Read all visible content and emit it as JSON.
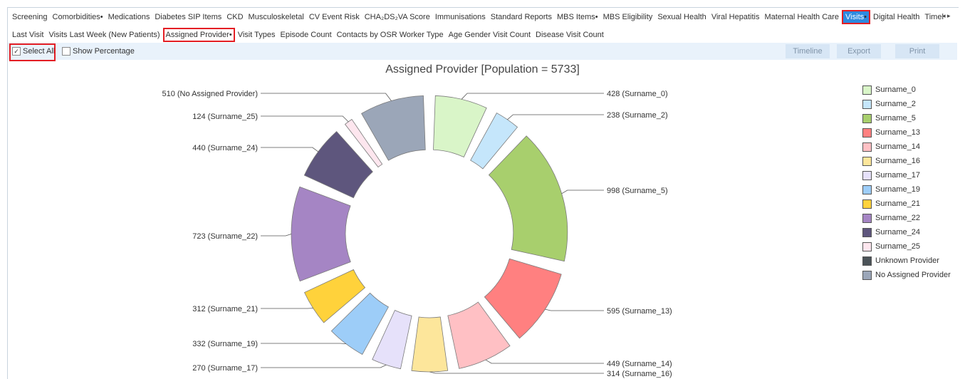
{
  "nav": {
    "tabs": [
      {
        "label": "Screening",
        "dot": false
      },
      {
        "label": "Comorbidities",
        "dot": true
      },
      {
        "label": "Medications",
        "dot": false
      },
      {
        "label": "Diabetes SIP Items",
        "dot": false
      },
      {
        "label": "CKD",
        "dot": false
      },
      {
        "label": "Musculoskeletal",
        "dot": false
      },
      {
        "label": "CV Event Risk",
        "dot": false
      },
      {
        "label": "CHA₂DS₂VA Score",
        "dot": false
      },
      {
        "label": "Immunisations",
        "dot": false
      },
      {
        "label": "Standard Reports",
        "dot": false
      },
      {
        "label": "MBS Items",
        "dot": true
      },
      {
        "label": "MBS Eligibility",
        "dot": false
      },
      {
        "label": "Sexual Health",
        "dot": false
      },
      {
        "label": "Viral Hepatitis",
        "dot": false
      },
      {
        "label": "Maternal Health Care",
        "dot": false
      },
      {
        "label": "Visits",
        "dot": true,
        "active": true
      },
      {
        "label": "Digital Health",
        "dot": false
      },
      {
        "label": "Timel",
        "dot": false
      }
    ],
    "scroll_arrows": "◂ ▸",
    "dot_char": "•"
  },
  "subnav": {
    "tabs": [
      {
        "label": "Last Visit",
        "dot": false
      },
      {
        "label": "Visits Last Week (New Patients)",
        "dot": false
      },
      {
        "label": "Assigned Provider",
        "dot": true,
        "active": true
      },
      {
        "label": "Visit Types",
        "dot": false
      },
      {
        "label": "Episode Count",
        "dot": false
      },
      {
        "label": "Contacts by OSR Worker Type",
        "dot": false
      },
      {
        "label": "Age Gender Visit Count",
        "dot": false
      },
      {
        "label": "Disease Visit Count",
        "dot": false
      }
    ]
  },
  "toolbar": {
    "select_all": "Select All",
    "select_all_checked": true,
    "check_mark": "✓",
    "show_percentage": "Show Percentage",
    "show_percentage_checked": false,
    "buttons": [
      "Timeline",
      "Export",
      "Print"
    ]
  },
  "chart_data": {
    "type": "pie",
    "title": "Assigned Provider [Population = 5733]",
    "donut": true,
    "slices": [
      {
        "name": "Surname_0",
        "value": 428,
        "label": "428 (Surname_0)",
        "color": "#d9f5c8"
      },
      {
        "name": "Surname_2",
        "value": 238,
        "label": "238 (Surname_2)",
        "color": "#c5e6fb"
      },
      {
        "name": "Surname_5",
        "value": 998,
        "label": "998 (Surname_5)",
        "color": "#a8cf6d"
      },
      {
        "name": "Surname_13",
        "value": 595,
        "label": "595 (Surname_13)",
        "color": "#ff8080"
      },
      {
        "name": "Surname_14",
        "value": 449,
        "label": "449 (Surname_14)",
        "color": "#ffc0c4"
      },
      {
        "name": "Surname_16",
        "value": 314,
        "label": "314 (Surname_16)",
        "color": "#fde69b"
      },
      {
        "name": "Surname_17",
        "value": 270,
        "label": "270 (Surname_17)",
        "color": "#e6e1fa"
      },
      {
        "name": "Surname_19",
        "value": 332,
        "label": "332 (Surname_19)",
        "color": "#9dcdf8"
      },
      {
        "name": "Surname_21",
        "value": 312,
        "label": "312 (Surname_21)",
        "color": "#ffd23b"
      },
      {
        "name": "Surname_22",
        "value": 723,
        "label": "723 (Surname_22)",
        "color": "#a585c4"
      },
      {
        "name": "Surname_24",
        "value": 440,
        "label": "440 (Surname_24)",
        "color": "#5e567d"
      },
      {
        "name": "Surname_25",
        "value": 124,
        "label": "124 (Surname_25)",
        "color": "#fde6ee"
      },
      {
        "name": "No Assigned Provider",
        "value": 510,
        "label": "510 (No Assigned Provider)",
        "color": "#9ba6b8"
      }
    ],
    "legend": [
      {
        "label": "Surname_0",
        "color": "#d9f5c8"
      },
      {
        "label": "Surname_2",
        "color": "#c5e6fb"
      },
      {
        "label": "Surname_5",
        "color": "#a8cf6d"
      },
      {
        "label": "Surname_13",
        "color": "#ff8080"
      },
      {
        "label": "Surname_14",
        "color": "#ffc0c4"
      },
      {
        "label": "Surname_16",
        "color": "#fde69b"
      },
      {
        "label": "Surname_17",
        "color": "#e6e1fa"
      },
      {
        "label": "Surname_19",
        "color": "#9dcdf8"
      },
      {
        "label": "Surname_21",
        "color": "#ffd23b"
      },
      {
        "label": "Surname_22",
        "color": "#a585c4"
      },
      {
        "label": "Surname_24",
        "color": "#5e567d"
      },
      {
        "label": "Surname_25",
        "color": "#fde6ee"
      },
      {
        "label": "Unknown Provider",
        "color": "#4b5358"
      },
      {
        "label": "No Assigned Provider",
        "color": "#9ba6b8"
      }
    ],
    "legend_position": "right"
  }
}
